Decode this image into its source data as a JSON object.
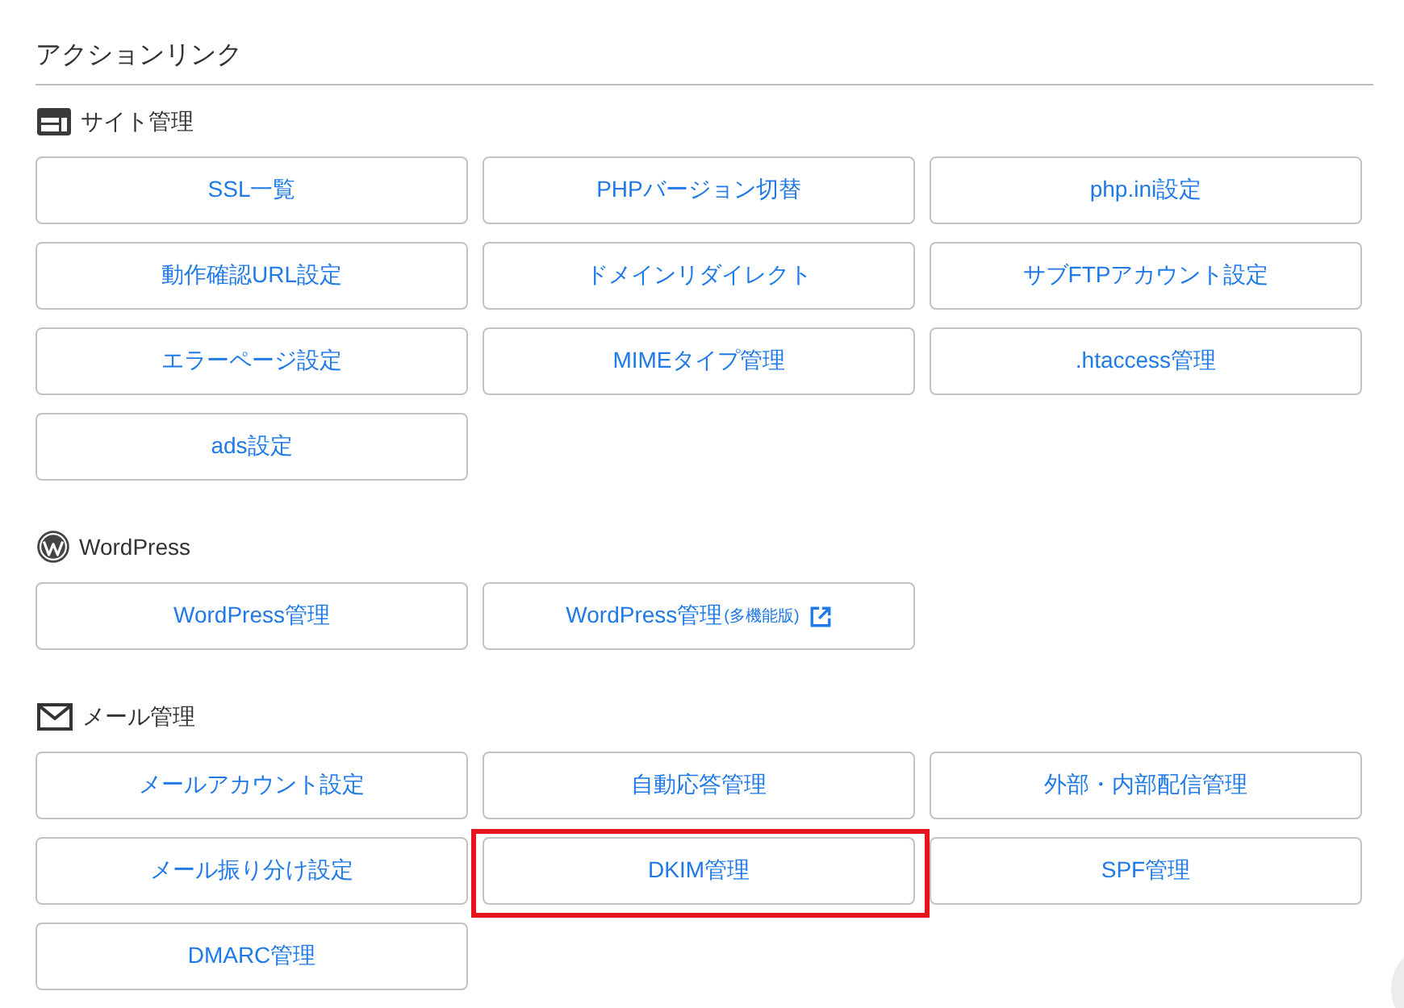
{
  "title": "アクションリンク",
  "sections": [
    {
      "kind": "site",
      "heading": "サイト管理",
      "buttons": [
        {
          "label": "SSL一覧",
          "highlighted": false
        },
        {
          "label": "PHPバージョン切替",
          "highlighted": false
        },
        {
          "label": "php.ini設定",
          "highlighted": false
        },
        {
          "label": "動作確認URL設定",
          "highlighted": false
        },
        {
          "label": "ドメインリダイレクト",
          "highlighted": false
        },
        {
          "label": "サブFTPアカウント設定",
          "highlighted": false
        },
        {
          "label": "エラーページ設定",
          "highlighted": false
        },
        {
          "label": "MIMEタイプ管理",
          "highlighted": false
        },
        {
          "label": ".htaccess管理",
          "highlighted": false
        },
        {
          "label": "ads設定",
          "highlighted": false
        }
      ]
    },
    {
      "kind": "cms",
      "heading": "WordPress",
      "buttons": [
        {
          "label": "WordPress管理",
          "highlighted": false
        },
        {
          "label": "WordPress管理",
          "note": "(多機能版)",
          "external": true,
          "highlighted": false
        }
      ]
    },
    {
      "kind": "mail",
      "heading": "メール管理",
      "buttons": [
        {
          "label": "メールアカウント設定",
          "highlighted": false
        },
        {
          "label": "自動応答管理",
          "highlighted": false
        },
        {
          "label": "外部・内部配信管理",
          "highlighted": false
        },
        {
          "label": "メール振り分け設定",
          "highlighted": false
        },
        {
          "label": "DKIM管理",
          "highlighted": true
        },
        {
          "label": "SPF管理",
          "highlighted": false
        },
        {
          "label": "DMARC管理",
          "highlighted": false
        }
      ]
    }
  ]
}
